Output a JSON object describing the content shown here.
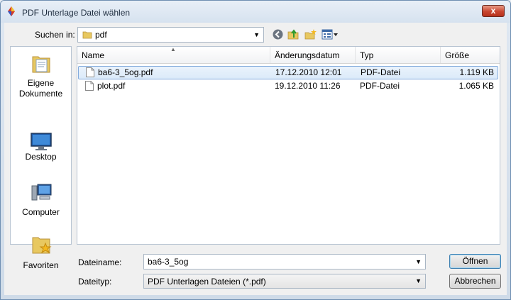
{
  "window": {
    "title": "PDF Unterlage Datei wählen"
  },
  "lookin": {
    "label": "Suchen in:",
    "value": "pdf"
  },
  "places": [
    {
      "label": "Eigene Dokumente",
      "icon": "documents-folder-icon"
    },
    {
      "label": "Desktop",
      "icon": "desktop-icon"
    },
    {
      "label": "Computer",
      "icon": "computer-icon"
    },
    {
      "label": "Favoriten",
      "icon": "favorites-folder-icon"
    }
  ],
  "list": {
    "columns": [
      "Name",
      "Änderungsdatum",
      "Typ",
      "Größe"
    ],
    "rows": [
      {
        "name": "ba6-3_5og.pdf",
        "date": "17.12.2010 12:01",
        "type": "PDF-Datei",
        "size": "1.119 KB",
        "selected": true
      },
      {
        "name": "plot.pdf",
        "date": "19.12.2010 11:26",
        "type": "PDF-Datei",
        "size": "1.065 KB",
        "selected": false
      }
    ]
  },
  "filename": {
    "label": "Dateiname:",
    "value": "ba6-3_5og"
  },
  "filetype": {
    "label": "Dateityp:",
    "value": "PDF Unterlagen Dateien (*.pdf)"
  },
  "buttons": {
    "open": "Öffnen",
    "cancel": "Abbrechen",
    "close": "x"
  },
  "colors": {
    "selection": "#dbeaf9",
    "close_button": "#c8452f",
    "folder": "#e8c860"
  }
}
